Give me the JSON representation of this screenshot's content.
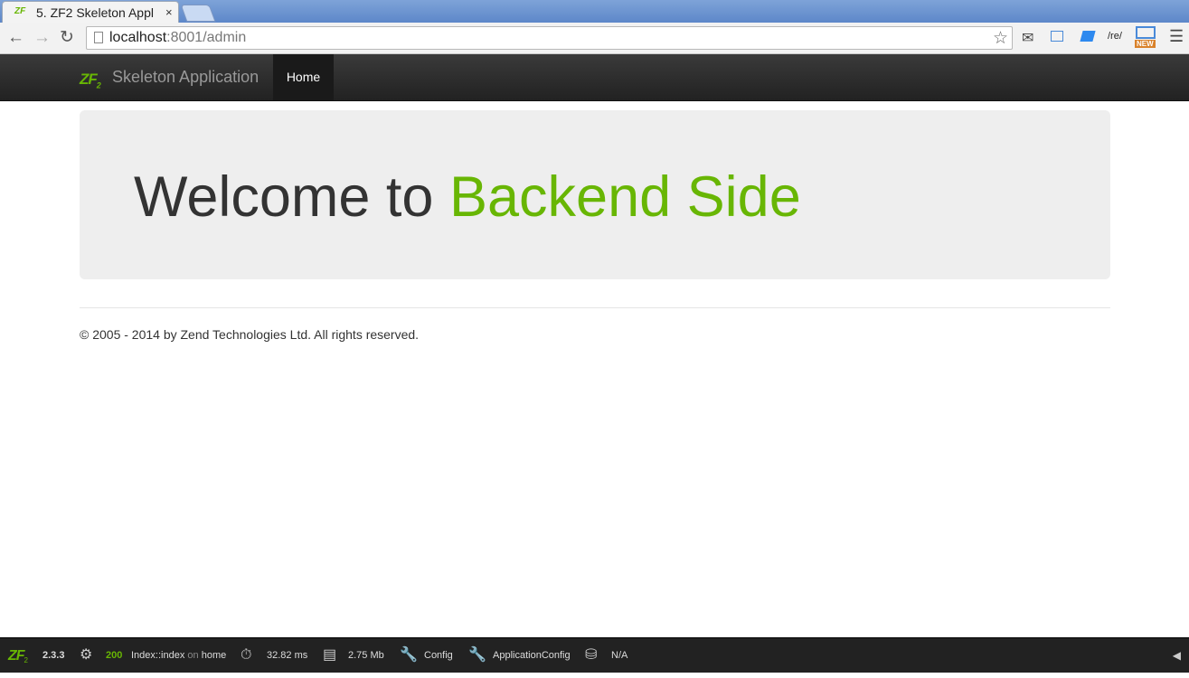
{
  "browser": {
    "tab_logo": "ZF",
    "tab_title": "5. ZF2 Skeleton Appl",
    "tab_close": "×",
    "url_host": "localhost",
    "url_rest": ":8001/admin",
    "ext_re": "/re/",
    "ext_new_badge": "NEW"
  },
  "navbar": {
    "brand_logo": "ZF",
    "brand_logo_sub": "2",
    "brand_text": "Skeleton Application",
    "items": [
      {
        "label": "Home",
        "active": true
      }
    ]
  },
  "jumbotron": {
    "welcome": "Welcome to",
    "accent": "Backend Side",
    "accent_color": "#68b604"
  },
  "footer": {
    "copyright": "© 2005 - 2014 by Zend Technologies Ltd. All rights reserved."
  },
  "devbar": {
    "logo": "ZF",
    "logo_sub": "2",
    "version": "2.3.3",
    "status_code": "200",
    "route": "Index::index",
    "route_on": "on",
    "route_name": "home",
    "time": "32.82 ms",
    "memory": "2.75 Mb",
    "config": "Config",
    "app_config": "ApplicationConfig",
    "db": "N/A"
  }
}
